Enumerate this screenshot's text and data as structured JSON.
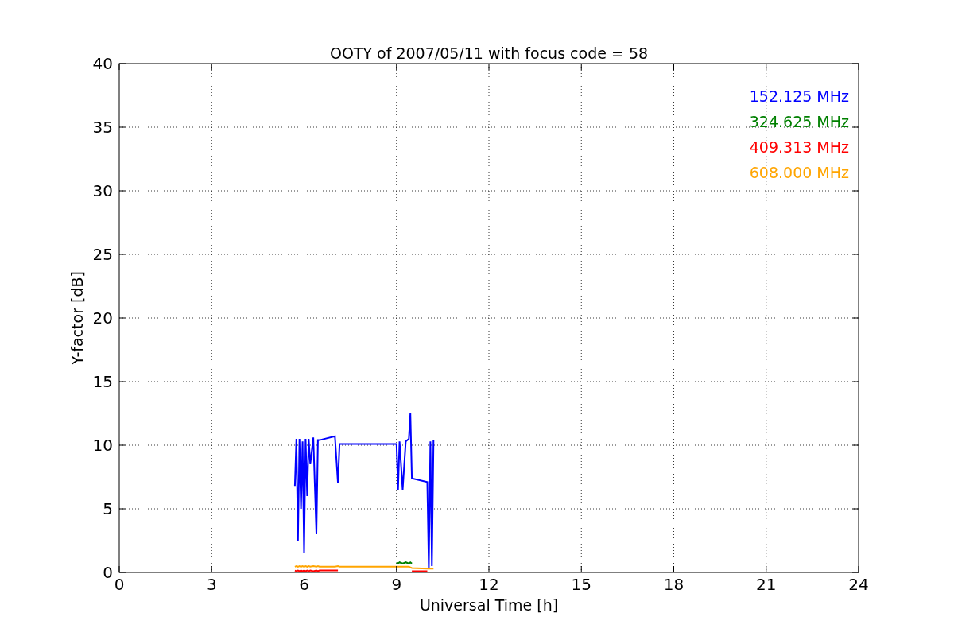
{
  "chart_data": {
    "type": "line",
    "title": "OOTY of 2007/05/11 with focus code = 58",
    "xlabel": "Universal Time [h]",
    "ylabel": "Y-factor [dB]",
    "x": [
      5.7,
      5.75,
      5.8,
      5.85,
      5.9,
      5.95,
      6.0,
      6.05,
      6.1,
      6.15,
      6.2,
      6.3,
      6.4,
      6.45,
      6.5,
      7.0,
      7.1,
      7.15,
      7.2,
      9.0,
      9.05,
      9.1,
      9.2,
      9.3,
      9.4,
      9.45,
      9.5,
      10.0,
      10.05,
      10.1,
      10.15,
      10.2
    ],
    "series": [
      {
        "name": "152.125 MHz",
        "color": "#0000ff",
        "values": [
          6.8,
          10.5,
          2.5,
          10.5,
          5,
          10.3,
          1.5,
          10.5,
          6,
          10.5,
          8.5,
          10.6,
          3,
          10.4,
          10.4,
          10.7,
          7,
          10.1,
          10.1,
          10.1,
          6.5,
          10.3,
          6.5,
          10.3,
          10.5,
          12.5,
          7.4,
          7.1,
          0.3,
          10.3,
          0.5,
          10.4
        ]
      },
      {
        "name": "324.625 MHz",
        "color": "#008000",
        "values": [
          null,
          null,
          null,
          null,
          null,
          null,
          null,
          null,
          null,
          null,
          null,
          null,
          null,
          null,
          null,
          null,
          null,
          null,
          null,
          0.8,
          0.7,
          0.8,
          0.7,
          0.8,
          0.7,
          0.8,
          0.7,
          null,
          null,
          null,
          null,
          null
        ]
      },
      {
        "name": "409.313 MHz",
        "color": "#ff0000",
        "values": [
          0.15,
          0.1,
          0.15,
          0.1,
          0.15,
          0.1,
          0.15,
          0.1,
          0.15,
          0.1,
          0.15,
          0.1,
          0.15,
          0.1,
          0.15,
          0.15,
          0.15,
          null,
          null,
          null,
          null,
          null,
          null,
          null,
          null,
          null,
          0.1,
          0.1,
          null,
          null,
          null,
          null
        ]
      },
      {
        "name": "608.000 MHz",
        "color": "#ffa500",
        "values": [
          0.45,
          0.5,
          0.45,
          0.5,
          0.45,
          0.5,
          0.45,
          0.5,
          0.45,
          0.5,
          0.45,
          0.5,
          0.45,
          0.5,
          0.45,
          0.45,
          0.5,
          0.45,
          0.45,
          0.45,
          0.45,
          0.45,
          0.45,
          0.45,
          0.45,
          0.4,
          0.35,
          0.3,
          0.3,
          0.3,
          0.3,
          0.3
        ]
      }
    ],
    "grid": true,
    "xlim": [
      0,
      24
    ],
    "ylim": [
      0,
      40
    ],
    "xticks": [
      0,
      3,
      6,
      9,
      12,
      15,
      18,
      21,
      24
    ],
    "yticks": [
      0,
      5,
      10,
      15,
      20,
      25,
      30,
      35,
      40
    ]
  }
}
